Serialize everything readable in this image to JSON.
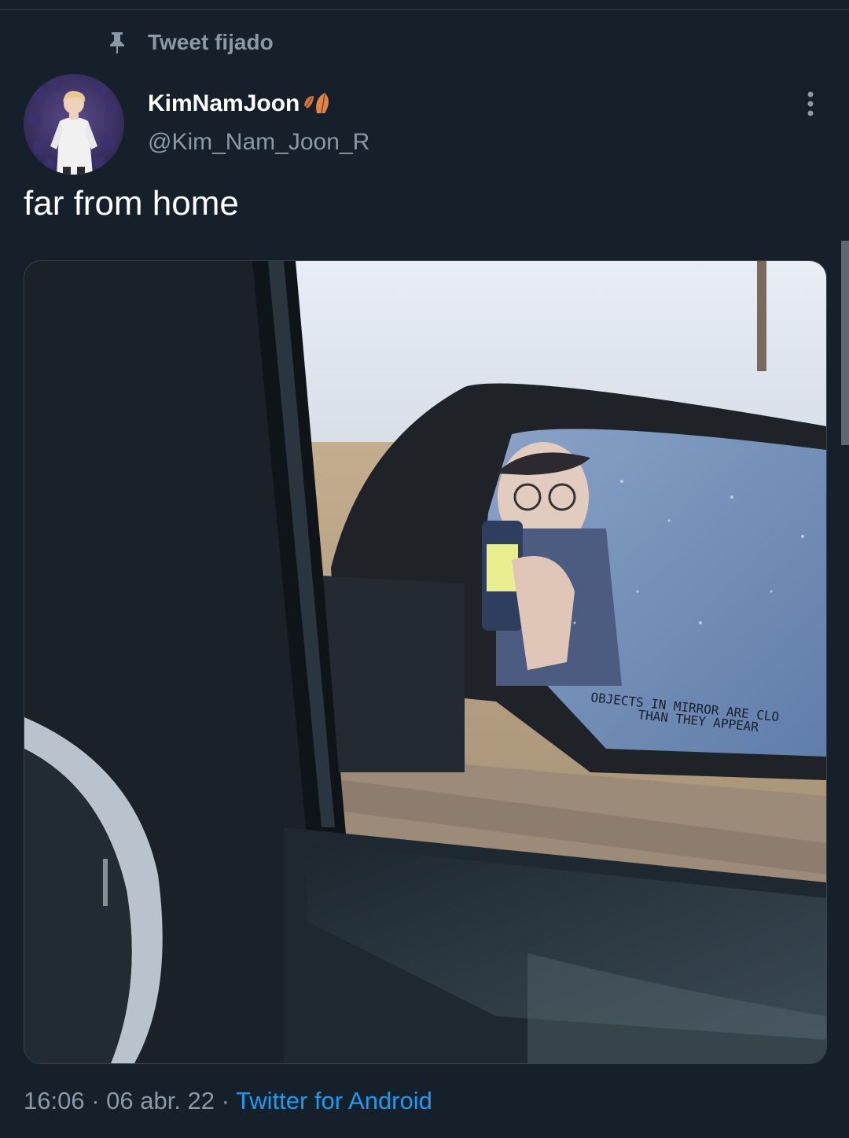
{
  "pinned": {
    "label": "Tweet fijado",
    "icon": "pin-icon"
  },
  "author": {
    "display_name": "KimNamJoon",
    "handle": "@Kim_Nam_Joon_R",
    "name_emoji": "leaf-icon"
  },
  "tweet": {
    "text": "far from home",
    "image_caption_lines": [
      "OBJECTS IN MIRROR ARE CLO",
      "THAN THEY APPEAR"
    ]
  },
  "meta": {
    "time": "16:06",
    "sep": " · ",
    "date": "06 abr. 22",
    "source": "Twitter for Android"
  },
  "colors": {
    "background": "#15202b",
    "secondary_text": "#8b98a5",
    "link": "#1d9bf0"
  }
}
